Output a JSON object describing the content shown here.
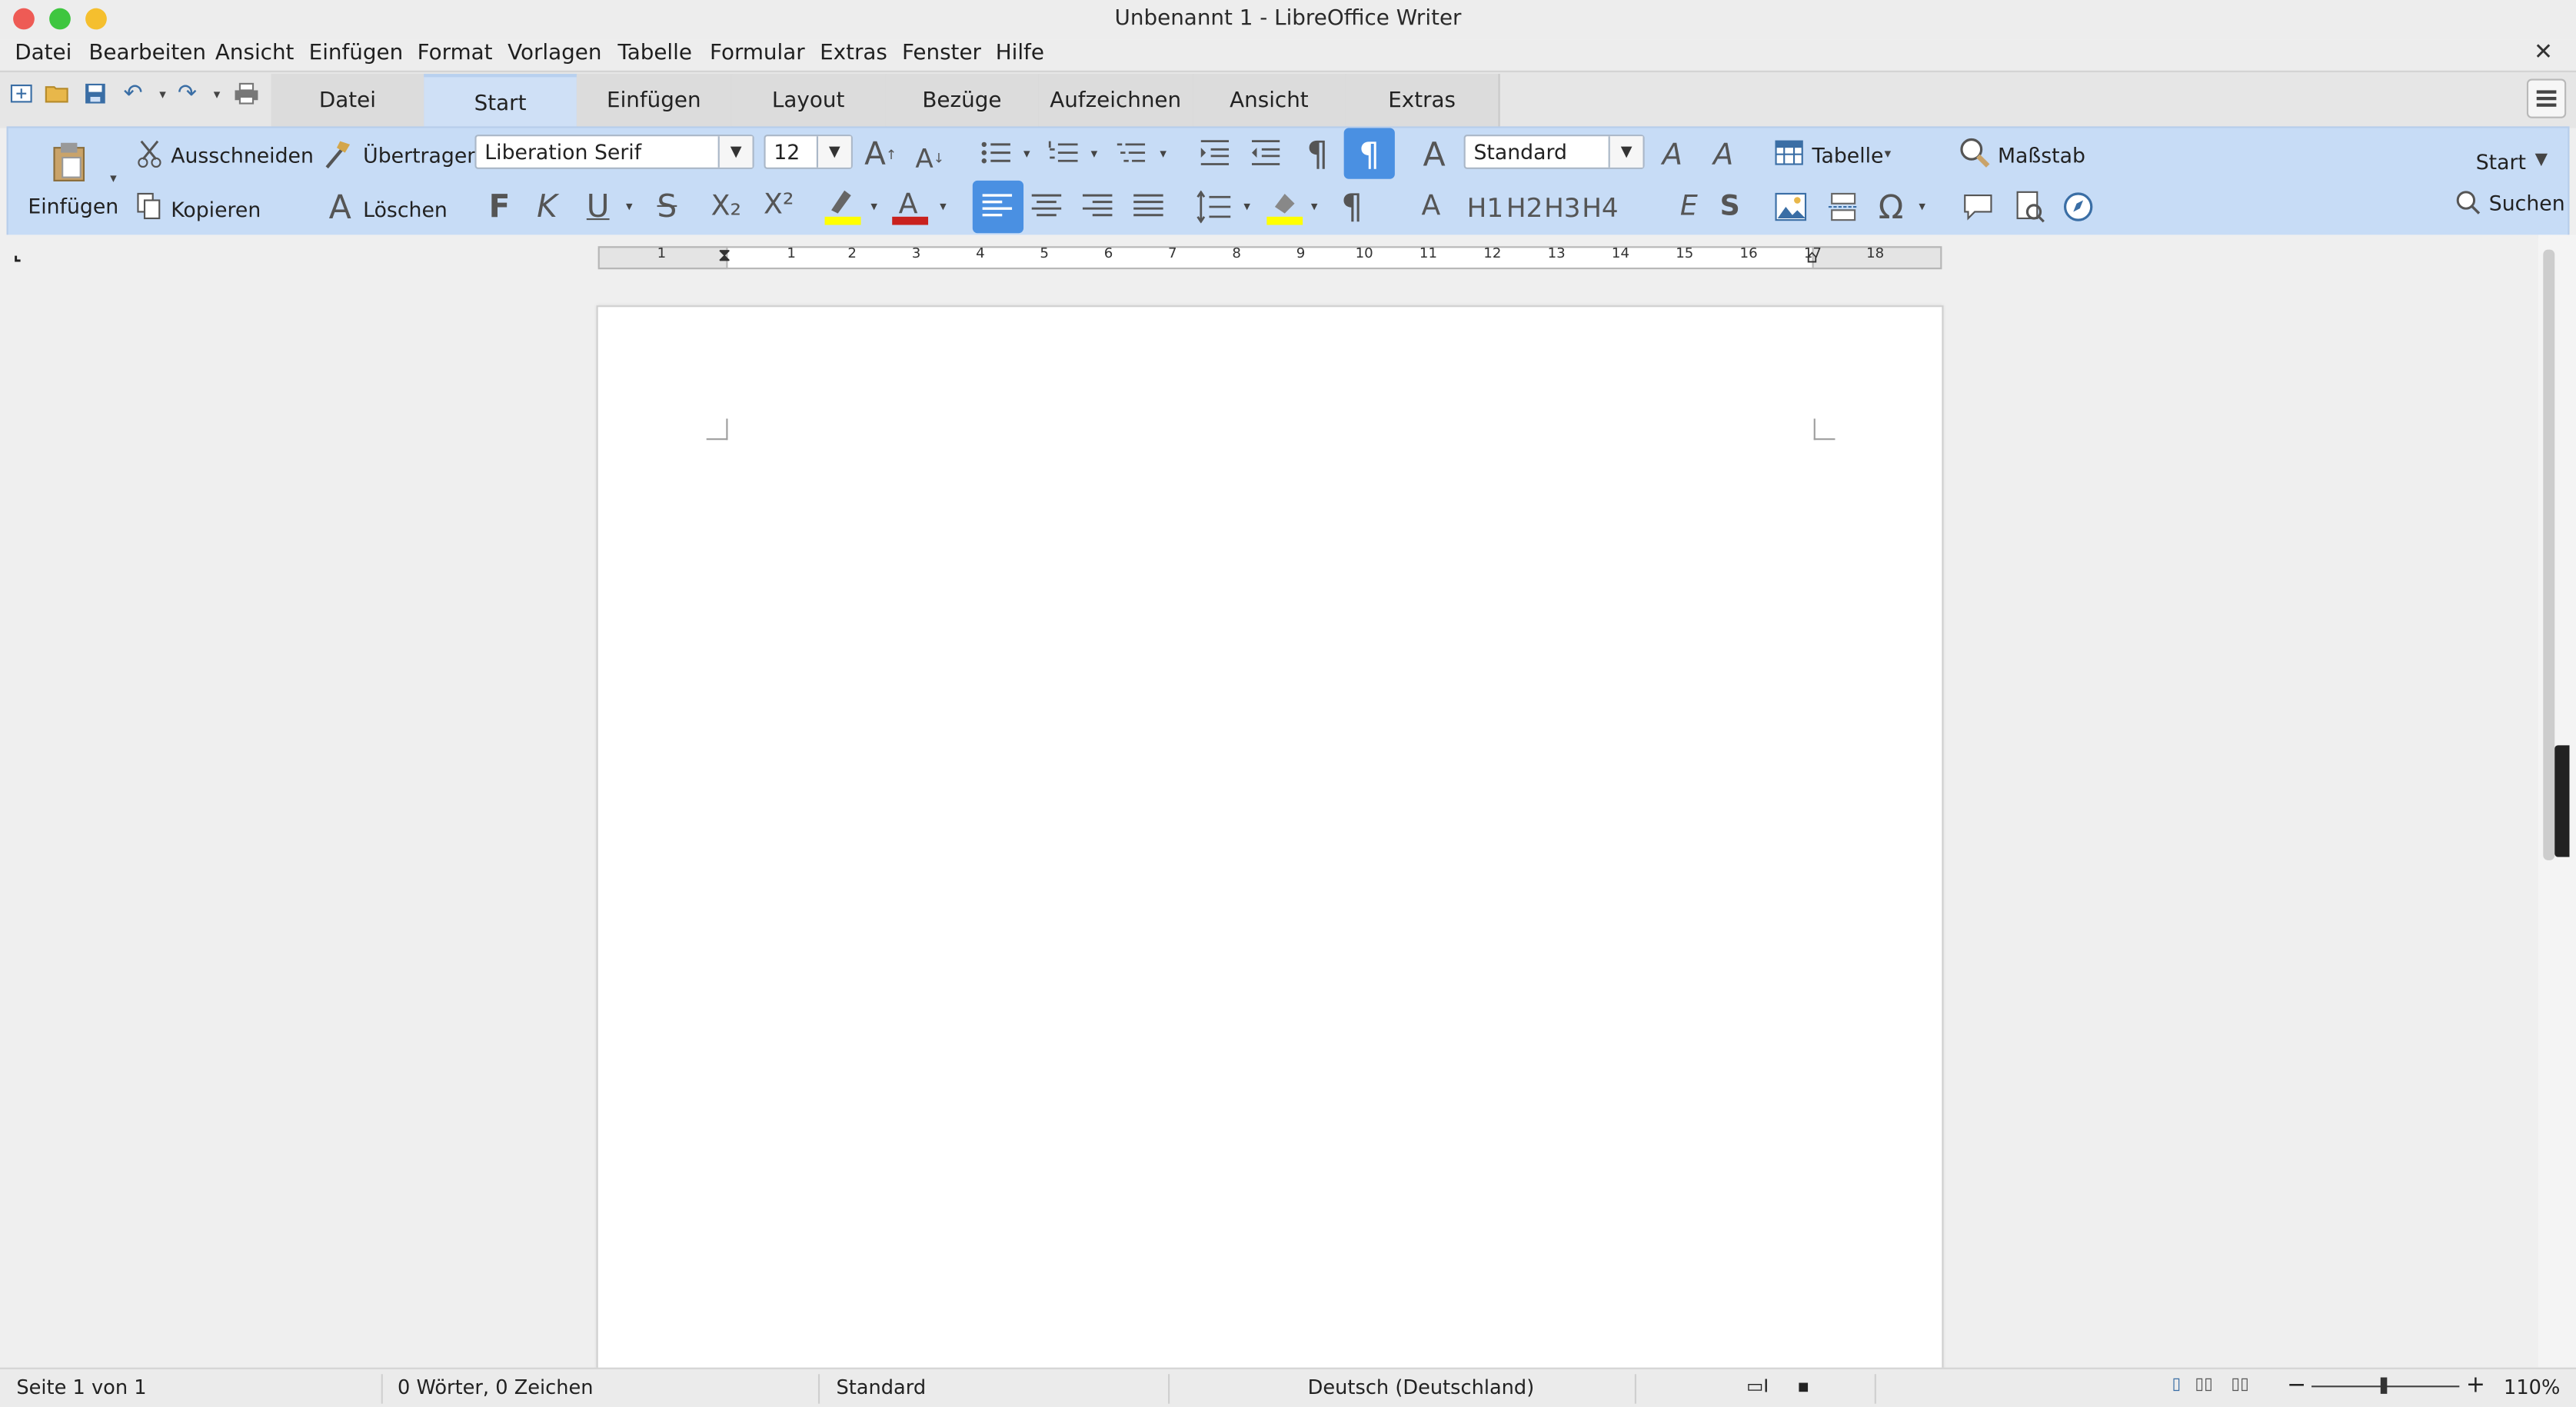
{
  "window": {
    "title": "Unbenannt 1 - LibreOffice Writer"
  },
  "menubar": {
    "items": [
      "Datei",
      "Bearbeiten",
      "Ansicht",
      "Einfügen",
      "Format",
      "Vorlagen",
      "Tabelle",
      "Formular",
      "Extras",
      "Fenster",
      "Hilfe"
    ],
    "close_symbol": "✕"
  },
  "tabs": [
    "Datei",
    "Start",
    "Einfügen",
    "Layout",
    "Bezüge",
    "Aufzeichnen",
    "Ansicht",
    "Extras"
  ],
  "active_tab": "Start",
  "toolbar": {
    "paste_label": "Einfügen",
    "cut_label": "Ausschneiden",
    "copy_label": "Kopieren",
    "clone_label": "Übertragen",
    "clear_label": "Löschen",
    "font_name": "Liberation Serif",
    "font_size": "12",
    "paragraph_style": "Standard",
    "bold": "F",
    "italic": "K",
    "underline": "U",
    "strike": "S",
    "subscript": "X₂",
    "superscript": "X²",
    "headings": [
      "A",
      "H1",
      "H2",
      "H3",
      "H4"
    ],
    "emphasis": "E",
    "strong": "S",
    "table_label": "Tabelle",
    "zoom_label": "Maßstab",
    "start_label": "Start",
    "search_label": "Suchen",
    "highlight_color": "#ffff00",
    "font_color": "#c9211e"
  },
  "ruler": {
    "numbers": [
      "1",
      "1",
      "2",
      "3",
      "4",
      "5",
      "6",
      "7",
      "8",
      "9",
      "10",
      "11",
      "12",
      "13",
      "14",
      "15",
      "16",
      "17",
      "18"
    ]
  },
  "statusbar": {
    "page": "Seite 1 von 1",
    "words": "0 Wörter, 0 Zeichen",
    "style": "Standard",
    "language": "Deutsch (Deutschland)",
    "zoom": "110%",
    "zoom_out": "−",
    "zoom_in": "+"
  }
}
